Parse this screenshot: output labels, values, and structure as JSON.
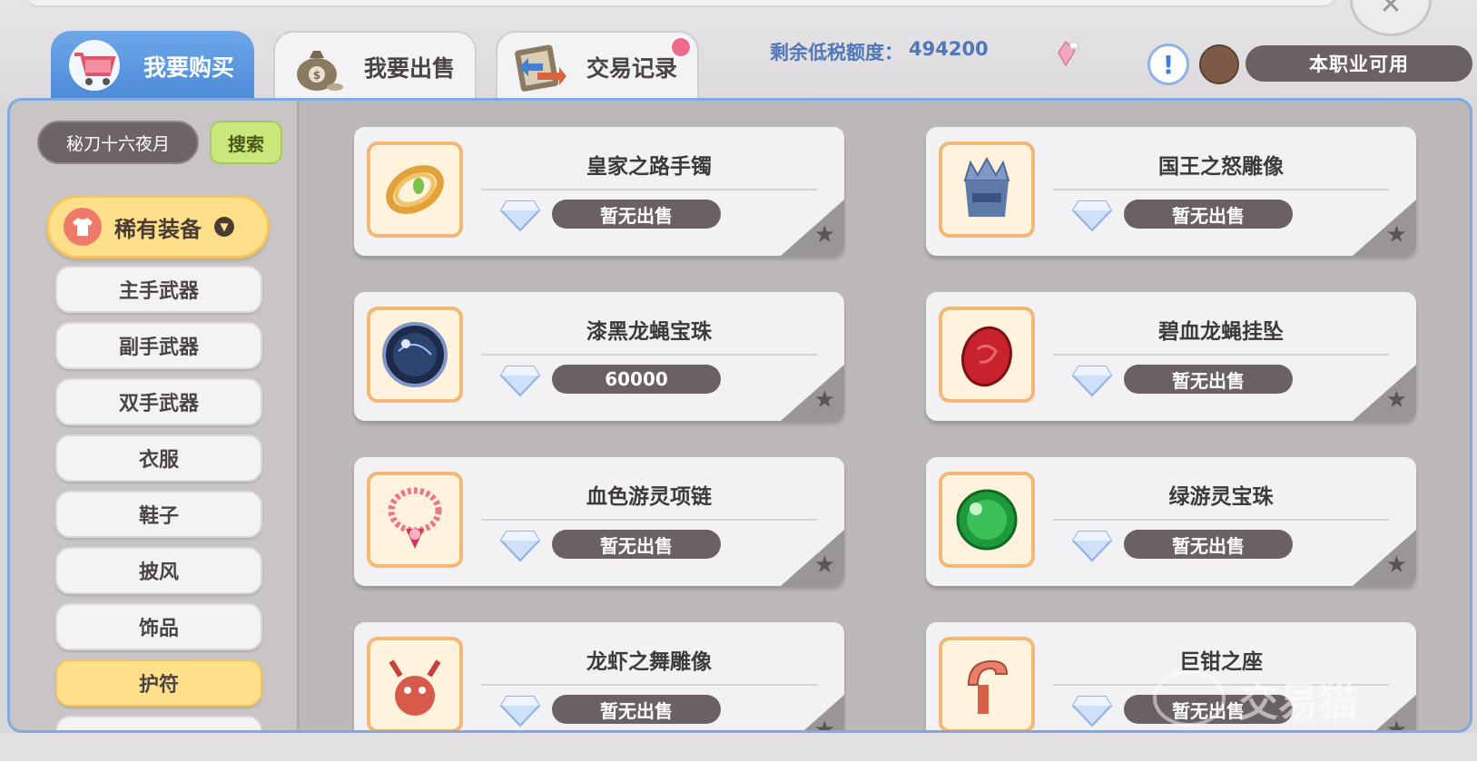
{
  "tabs": [
    {
      "label": "我要购买",
      "active": true,
      "icon": "shopping-cart-icon"
    },
    {
      "label": "我要出售",
      "active": false,
      "icon": "money-bag-icon"
    },
    {
      "label": "交易记录",
      "active": false,
      "icon": "record-book-icon"
    }
  ],
  "header": {
    "tax_label": "剩余低税额度：",
    "tax_value": "494200",
    "usable_button": "本职业可用",
    "info_icon": "!"
  },
  "sidebar": {
    "search_value": "秘刀十六夜月",
    "search_button": "搜索",
    "category": "稀有装备",
    "sub_items": [
      "主手武器",
      "副手武器",
      "双手武器",
      "衣服",
      "鞋子",
      "披风",
      "饰品",
      "护符"
    ],
    "selected_sub_item": "护符"
  },
  "items": [
    {
      "name": "皇家之路手镯",
      "price": "暂无出售",
      "icon": "bracelet-icon"
    },
    {
      "name": "国王之怒雕像",
      "price": "暂无出售",
      "icon": "crown-statue-icon"
    },
    {
      "name": "漆黑龙蝇宝珠",
      "price": "60000",
      "icon": "dark-orb-icon"
    },
    {
      "name": "碧血龙蝇挂坠",
      "price": "暂无出售",
      "icon": "red-pendant-icon"
    },
    {
      "name": "血色游灵项链",
      "price": "暂无出售",
      "icon": "necklace-icon"
    },
    {
      "name": "绿游灵宝珠",
      "price": "暂无出售",
      "icon": "green-orb-icon"
    },
    {
      "name": "龙虾之舞雕像",
      "price": "暂无出售",
      "icon": "lobster-statue-icon"
    },
    {
      "name": "巨钳之座",
      "price": "暂无出售",
      "icon": "claw-seat-icon"
    }
  ],
  "watermark": "交易猫",
  "colors": {
    "accent_blue": "#4c8ad8",
    "selected_yellow": "#ffe08a",
    "pill_dark": "#6b6163",
    "search_green": "#c9e77a"
  }
}
